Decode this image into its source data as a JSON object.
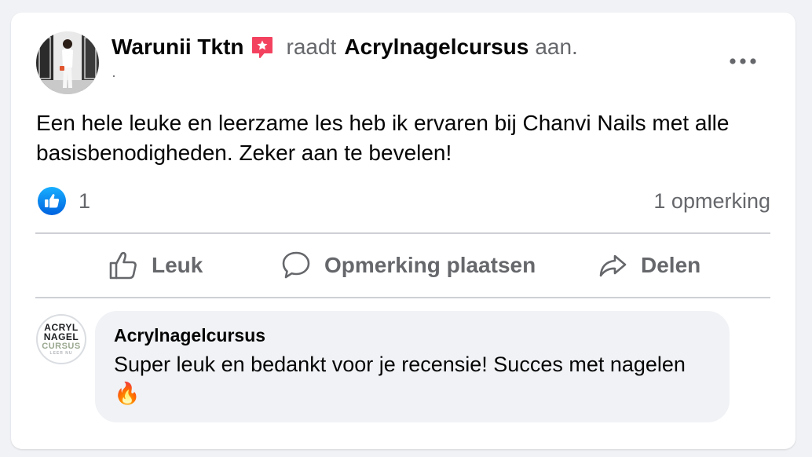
{
  "post": {
    "author": "Warunii Tktn",
    "verb": "raadt",
    "page": "Acrylnagelcursus",
    "suffix": "aan.",
    "subline": "·",
    "text": "Een hele leuke en leerzame les heb ik ervaren bij Chanvi Nails met alle basisbenodigheden. Zeker aan te bevelen!"
  },
  "stats": {
    "like_count": "1",
    "comment_count": "1 opmerking"
  },
  "actions": {
    "like": "Leuk",
    "comment": "Opmerking plaatsen",
    "share": "Delen"
  },
  "comment": {
    "author": "Acrylnagelcursus",
    "text": "Super leuk en bedankt voor je recensie! Succes met nagelen🔥",
    "logo": {
      "line1": "ACRYL",
      "line2": "NAGEL",
      "line3": "CURSUS",
      "line4": "LEER NU"
    }
  },
  "colors": {
    "facebook_blue": "#1877f2",
    "recommend_pink": "#f3425f",
    "secondary_text": "#65676b",
    "bubble_bg": "#f0f2f5"
  },
  "icons": {
    "recommend": "recommend-star-icon",
    "more": "more-options-icon",
    "like_reaction": "thumbs-up-reaction-icon",
    "like": "thumbs-up-icon",
    "comment": "speech-bubble-icon",
    "share": "share-arrow-icon"
  }
}
